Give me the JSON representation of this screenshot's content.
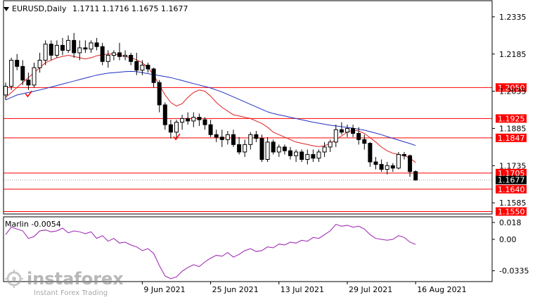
{
  "header": {
    "symbol": "EURUSD,Daily",
    "ohlc": "1.1711 1.1716 1.1675 1.1677"
  },
  "colors": {
    "up_candle": "#ffffff",
    "down_candle": "#000000",
    "red_line": "#ff0000",
    "ma_fast": "#e02020",
    "ma_slow": "#2030c0",
    "marlin": "#9a1fb0",
    "current_price_box": "#000000"
  },
  "chart_data": [
    {
      "type": "candlestick",
      "panel": "main",
      "ylim": [
        1.154,
        1.24
      ],
      "yticks": [
        1.2335,
        1.2185,
        1.2035,
        1.1885,
        1.1735,
        1.1585
      ],
      "xlabels": [
        "9 Jun 2021",
        "25 Jun 2021",
        "13 Jul 2021",
        "29 Jul 2021",
        "16 Aug 2021"
      ],
      "xlabel_index": [
        24,
        36,
        48,
        60,
        72
      ],
      "current_price": 1.1677,
      "hlines": [
        {
          "value": 1.205,
          "label": "1.2050"
        },
        {
          "value": 1.1925,
          "label": "1.1925"
        },
        {
          "value": 1.1847,
          "label": "1.1847"
        },
        {
          "value": 1.1705,
          "label": "1.1705"
        },
        {
          "value": 1.164,
          "label": "1.1640"
        },
        {
          "value": 1.155,
          "label": "1.1550"
        }
      ],
      "checkmarks": [
        {
          "index": 4,
          "value": 1.2025
        },
        {
          "index": 30,
          "value": 1.1852
        }
      ],
      "candles": [
        [
          1.202,
          1.207,
          1.2,
          1.2055
        ],
        [
          1.2055,
          1.217,
          1.204,
          1.216
        ],
        [
          1.216,
          1.2185,
          1.212,
          1.2135
        ],
        [
          1.2135,
          1.216,
          1.206,
          1.208
        ],
        [
          1.208,
          1.211,
          1.204,
          1.206
        ],
        [
          1.206,
          1.215,
          1.205,
          1.213
        ],
        [
          1.213,
          1.219,
          1.211,
          1.216
        ],
        [
          1.216,
          1.224,
          1.214,
          1.2225
        ],
        [
          1.2225,
          1.224,
          1.216,
          1.218
        ],
        [
          1.218,
          1.224,
          1.217,
          1.222
        ],
        [
          1.222,
          1.225,
          1.218,
          1.22
        ],
        [
          1.22,
          1.226,
          1.219,
          1.224
        ],
        [
          1.224,
          1.227,
          1.217,
          1.219
        ],
        [
          1.219,
          1.224,
          1.216,
          1.221
        ],
        [
          1.221,
          1.224,
          1.219,
          1.2205
        ],
        [
          1.2205,
          1.224,
          1.219,
          1.223
        ],
        [
          1.223,
          1.225,
          1.22,
          1.2215
        ],
        [
          1.2215,
          1.223,
          1.214,
          1.2155
        ],
        [
          1.2155,
          1.22,
          1.213,
          1.218
        ],
        [
          1.218,
          1.22,
          1.216,
          1.219
        ],
        [
          1.219,
          1.223,
          1.216,
          1.2175
        ],
        [
          1.2175,
          1.22,
          1.216,
          1.218
        ],
        [
          1.218,
          1.219,
          1.214,
          1.2155
        ],
        [
          1.2155,
          1.219,
          1.21,
          1.212
        ],
        [
          1.212,
          1.216,
          1.21,
          1.214
        ],
        [
          1.214,
          1.215,
          1.211,
          1.2125
        ],
        [
          1.2125,
          1.213,
          1.205,
          1.207
        ],
        [
          1.207,
          1.208,
          1.195,
          1.198
        ],
        [
          1.198,
          1.199,
          1.188,
          1.19
        ],
        [
          1.19,
          1.192,
          1.1845,
          1.187
        ],
        [
          1.187,
          1.192,
          1.184,
          1.191
        ],
        [
          1.191,
          1.194,
          1.188,
          1.1925
        ],
        [
          1.1925,
          1.195,
          1.19,
          1.1915
        ],
        [
          1.1915,
          1.195,
          1.189,
          1.193
        ],
        [
          1.193,
          1.1945,
          1.1895,
          1.192
        ],
        [
          1.192,
          1.193,
          1.188,
          1.19
        ],
        [
          1.19,
          1.192,
          1.185,
          1.186
        ],
        [
          1.186,
          1.188,
          1.183,
          1.185
        ],
        [
          1.185,
          1.188,
          1.181,
          1.184
        ],
        [
          1.184,
          1.1875,
          1.182,
          1.186
        ],
        [
          1.186,
          1.188,
          1.181,
          1.182
        ],
        [
          1.182,
          1.185,
          1.178,
          1.179
        ],
        [
          1.179,
          1.184,
          1.177,
          1.182
        ],
        [
          1.182,
          1.187,
          1.18,
          1.186
        ],
        [
          1.186,
          1.1875,
          1.183,
          1.1845
        ],
        [
          1.1845,
          1.186,
          1.175,
          1.176
        ],
        [
          1.176,
          1.185,
          1.175,
          1.183
        ],
        [
          1.183,
          1.184,
          1.178,
          1.179
        ],
        [
          1.179,
          1.182,
          1.177,
          1.181
        ],
        [
          1.181,
          1.182,
          1.178,
          1.1795
        ],
        [
          1.1795,
          1.181,
          1.176,
          1.1775
        ],
        [
          1.1775,
          1.18,
          1.175,
          1.179
        ],
        [
          1.179,
          1.18,
          1.175,
          1.176
        ],
        [
          1.176,
          1.18,
          1.174,
          1.178
        ],
        [
          1.178,
          1.18,
          1.175,
          1.1765
        ],
        [
          1.1765,
          1.18,
          1.175,
          1.179
        ],
        [
          1.179,
          1.183,
          1.177,
          1.181
        ],
        [
          1.181,
          1.184,
          1.179,
          1.183
        ],
        [
          1.183,
          1.19,
          1.181,
          1.188
        ],
        [
          1.188,
          1.191,
          1.186,
          1.187
        ],
        [
          1.187,
          1.19,
          1.185,
          1.1885
        ],
        [
          1.1885,
          1.19,
          1.185,
          1.1865
        ],
        [
          1.1865,
          1.189,
          1.182,
          1.184
        ],
        [
          1.184,
          1.186,
          1.18,
          1.1825
        ],
        [
          1.1825,
          1.183,
          1.173,
          1.175
        ],
        [
          1.175,
          1.177,
          1.172,
          1.174
        ],
        [
          1.174,
          1.176,
          1.171,
          1.172
        ],
        [
          1.172,
          1.175,
          1.17,
          1.1735
        ],
        [
          1.1735,
          1.1745,
          1.171,
          1.1725
        ],
        [
          1.1725,
          1.179,
          1.172,
          1.178
        ],
        [
          1.178,
          1.179,
          1.176,
          1.1775
        ],
        [
          1.1775,
          1.178,
          1.169,
          1.1711
        ],
        [
          1.1711,
          1.1716,
          1.1675,
          1.1677
        ]
      ],
      "ma_fast": [
        1.201,
        1.203,
        1.205,
        1.207,
        1.209,
        1.211,
        1.213,
        1.215,
        1.216,
        1.217,
        1.2175,
        1.218,
        1.2175,
        1.217,
        1.2165,
        1.217,
        1.2178,
        1.2182,
        1.2185,
        1.2185,
        1.218,
        1.2175,
        1.217,
        1.2162,
        1.215,
        1.213,
        1.21,
        1.206,
        1.202,
        1.199,
        1.1975,
        1.1985,
        1.201,
        1.203,
        1.204,
        1.2035,
        1.2015,
        1.199,
        1.197,
        1.1955,
        1.194,
        1.1935,
        1.193,
        1.1925,
        1.1915,
        1.1905,
        1.189,
        1.187,
        1.186,
        1.185,
        1.184,
        1.183,
        1.1825,
        1.182,
        1.1815,
        1.1812,
        1.1815,
        1.1825,
        1.184,
        1.1855,
        1.187,
        1.1878,
        1.1875,
        1.1865,
        1.1848,
        1.183,
        1.181,
        1.1795,
        1.1785,
        1.178,
        1.1775,
        1.1765,
        1.1748
      ],
      "ma_slow": [
        1.2,
        1.201,
        1.202,
        1.2025,
        1.203,
        1.2035,
        1.204,
        1.2046,
        1.2052,
        1.2058,
        1.2064,
        1.207,
        1.2076,
        1.2082,
        1.2088,
        1.2094,
        1.21,
        1.2104,
        1.2108,
        1.211,
        1.2112,
        1.2114,
        1.2115,
        1.2114,
        1.211,
        1.2106,
        1.2102,
        1.2098,
        1.2094,
        1.209,
        1.2084,
        1.2078,
        1.2072,
        1.2066,
        1.206,
        1.2054,
        1.2048,
        1.204,
        1.2032,
        1.2022,
        1.2012,
        1.2002,
        1.1992,
        1.1982,
        1.1972,
        1.1962,
        1.1952,
        1.1945,
        1.194,
        1.1935,
        1.193,
        1.1925,
        1.192,
        1.1915,
        1.191,
        1.1906,
        1.1902,
        1.1898,
        1.1895,
        1.1892,
        1.1889,
        1.1886,
        1.1882,
        1.1878,
        1.1872,
        1.1866,
        1.186,
        1.1852,
        1.1845,
        1.1838,
        1.1831,
        1.1824,
        1.1816
      ]
    },
    {
      "type": "line",
      "panel": "oscillator",
      "title": "Marlin -0.0054",
      "ylim": [
        -0.045,
        0.024
      ],
      "yticks": [
        0.018,
        0.0,
        -0.0335
      ],
      "ytick_labels": [
        "0.018",
        "0.00",
        "-0.0335"
      ],
      "series": [
        {
          "name": "Marlin",
          "values": [
            0.005,
            0.013,
            0.011,
            0.009,
            0.001,
            0.003,
            0.009,
            0.01,
            0.008,
            0.009,
            0.012,
            0.007,
            0.009,
            0.008,
            0.006,
            0.008,
            0.001,
            0.004,
            -0.002,
            0.001,
            -0.004,
            -0.003,
            -0.006,
            -0.008,
            -0.012,
            -0.01,
            -0.015,
            -0.028,
            -0.039,
            -0.042,
            -0.04,
            -0.034,
            -0.03,
            -0.027,
            -0.029,
            -0.024,
            -0.02,
            -0.017,
            -0.018,
            -0.014,
            -0.019,
            -0.016,
            -0.012,
            -0.01,
            -0.013,
            -0.012,
            -0.008,
            -0.009,
            -0.005,
            -0.006,
            -0.003,
            -0.004,
            -0.001,
            -0.002,
            0.002,
            0.001,
            0.005,
            0.009,
            0.016,
            0.014,
            0.015,
            0.013,
            0.014,
            0.011,
            0.005,
            0.001,
            0.0,
            -0.001,
            0.0,
            0.004,
            0.002,
            -0.003,
            -0.0054
          ]
        }
      ]
    }
  ],
  "watermark": {
    "brand": "instaforex",
    "tagline": "Instant Forex Trading"
  }
}
